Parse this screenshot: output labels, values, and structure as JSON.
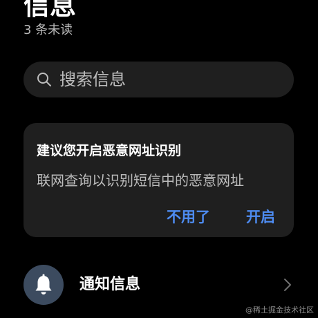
{
  "header": {
    "title": "信息",
    "unread_text": "3 条未读"
  },
  "search": {
    "placeholder": "搜索信息",
    "icon": "search-icon"
  },
  "security_card": {
    "title": "建议您开启恶意网址识别",
    "description": "联网查询以识别短信中的恶意网址",
    "dismiss_label": "不用了",
    "enable_label": "开启",
    "accent_color": "#4e8cf2"
  },
  "notifications": {
    "label": "通知信息",
    "icon": "bell-icon",
    "chevron": "chevron-right-icon"
  },
  "watermark": "@稀土掘金技术社区"
}
